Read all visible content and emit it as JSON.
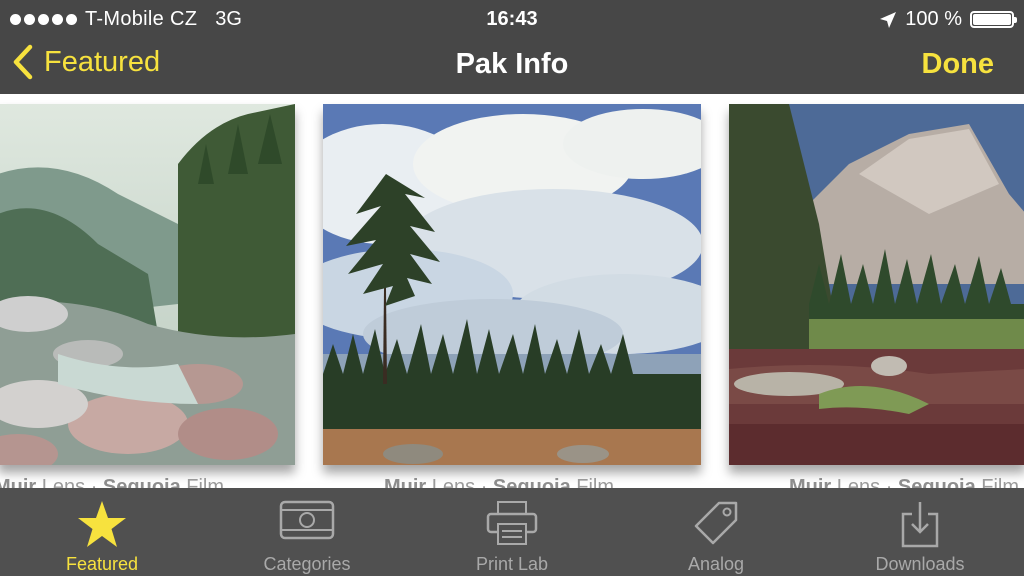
{
  "status_bar": {
    "carrier": "T-Mobile CZ",
    "network": "3G",
    "time": "16:43",
    "battery_text": "100 %",
    "battery_level": 1.0
  },
  "nav": {
    "back_label": "Featured",
    "title": "Pak Info",
    "done_label": "Done"
  },
  "gallery": {
    "photos": [
      {
        "name": "river-valley-photo",
        "caption_lens": "Muir",
        "caption_lens_suffix": " Lens  ·  ",
        "caption_film": "Sequoia",
        "caption_film_suffix": " Film"
      },
      {
        "name": "pine-tree-clouds-photo",
        "caption_lens": "Muir",
        "caption_lens_suffix": " Lens  ·  ",
        "caption_film": "Sequoia",
        "caption_film_suffix": " Film"
      },
      {
        "name": "mountain-lake-photo",
        "caption_lens": "Muir",
        "caption_lens_suffix": " Lens  ·  ",
        "caption_film": "Sequoia",
        "caption_film_suffix": " Film"
      }
    ]
  },
  "tabbar": {
    "tabs": [
      {
        "label": "Featured",
        "icon": "star-icon",
        "active": true
      },
      {
        "label": "Categories",
        "icon": "film-frame-icon",
        "active": false
      },
      {
        "label": "Print Lab",
        "icon": "printer-icon",
        "active": false
      },
      {
        "label": "Analog",
        "icon": "tag-icon",
        "active": false
      },
      {
        "label": "Downloads",
        "icon": "download-tray-icon",
        "active": false
      }
    ]
  },
  "colors": {
    "accent": "#f7e23e",
    "bar_background": "#474747",
    "tabbar_background": "#505050",
    "inactive_tab": "#a9a9a9"
  }
}
